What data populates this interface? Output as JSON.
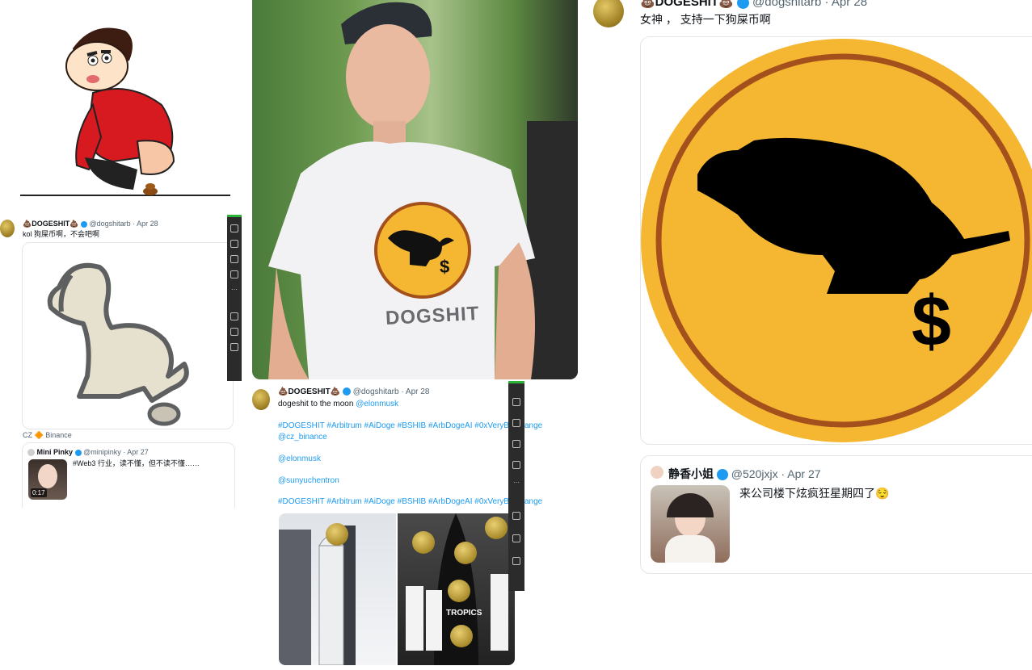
{
  "tweet_large": {
    "display_name": "💩DOGESHIT💩",
    "handle": "@dogshitarb",
    "dot": "·",
    "date": "Apr 28",
    "text": "女神 ， 支持一下狗屎币啊"
  },
  "tweet_jingxiang": {
    "display_name": "静香小姐",
    "handle": "@520jxjx",
    "dot": "·",
    "date": "Apr 27",
    "text": "来公司楼下炫疯狂星期四了😌"
  },
  "tweet_small_left": {
    "display_name": "💩DOGESHIT💩",
    "handle": "@dogshitarb",
    "dot": "·",
    "date": "Apr 28",
    "text": "kol 狗屎币啊，不会吧啊"
  },
  "left_footer": {
    "text": "CZ 🔶 Binance"
  },
  "tweet_mini_pinky": {
    "display_name": "Mini Pinky",
    "handle": "@minipinky",
    "dot": "·",
    "date": "Apr 27",
    "text": "#Web3 行业，读不懂，但不读不懂……",
    "video_time": "0:17"
  },
  "tweet_middle": {
    "display_name": "💩DOGESHIT💩",
    "handle": "@dogshitarb",
    "dot": "·",
    "date": "Apr 28",
    "line1_text": "dogeshit  to  the moon",
    "line1_mention": "@elonmusk",
    "hashtags1": "#DOGESHIT #Arbitrum #AiDoge #BSHIB #ArbDogeAI #0xVeryBigOrange",
    "mention_cz": "@cz_binance",
    "mention_elon": "@elonmusk",
    "mention_sun": "@sunyuchentron",
    "hashtags2": "#DOGESHIT #Arbitrum #AiDoge #BSHIB #ArbDogeAI #0xVeryBigOrange",
    "image_label": "TROPICS"
  },
  "shirt_photo": {
    "shirt_text": "DOGSHIT"
  },
  "colors": {
    "coin_yellow": "#f5b731",
    "coin_ring": "#a4501c",
    "link_blue": "#1d9bf0",
    "sidebar_dark": "#2b2b2b"
  }
}
